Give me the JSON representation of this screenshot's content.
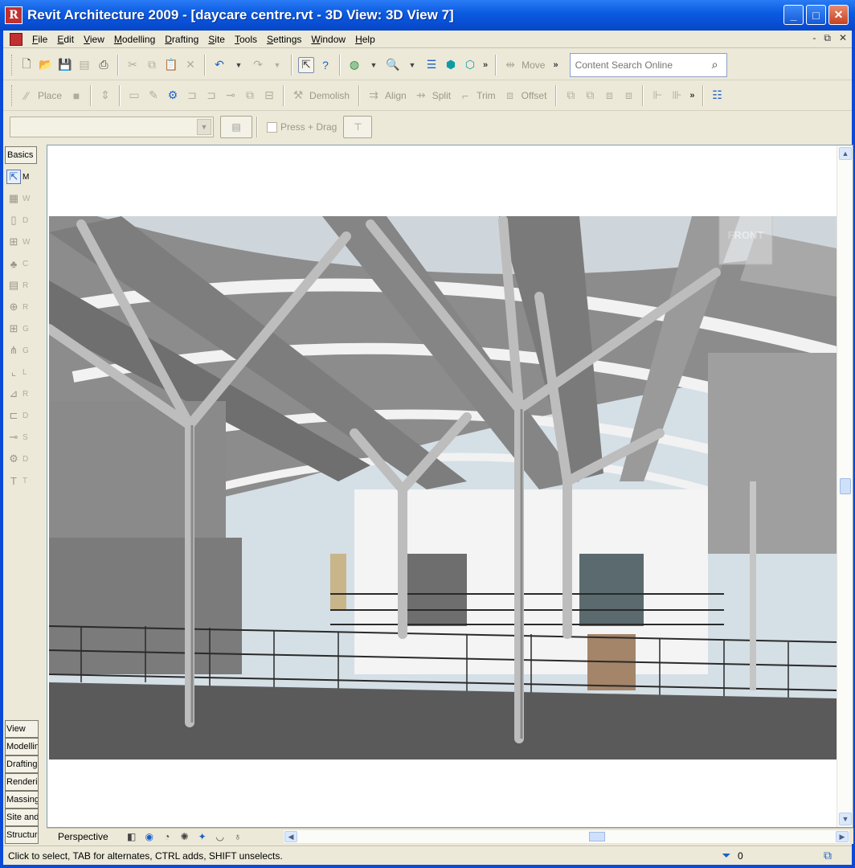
{
  "window": {
    "title": "Revit Architecture 2009 - [daycare centre.rvt - 3D View: 3D View 7]",
    "app_icon": "R",
    "minimize": "_",
    "maximize": "□",
    "close": "✕"
  },
  "menu": [
    {
      "label": "File",
      "key": "F",
      "rest": "ile"
    },
    {
      "label": "Edit",
      "key": "E",
      "rest": "dit"
    },
    {
      "label": "View",
      "key": "V",
      "rest": "iew"
    },
    {
      "label": "Modelling",
      "key": "M",
      "rest": "odelling"
    },
    {
      "label": "Drafting",
      "key": "D",
      "rest": "rafting"
    },
    {
      "label": "Site",
      "key": "S",
      "rest": "ite"
    },
    {
      "label": "Tools",
      "key": "T",
      "rest": "ools"
    },
    {
      "label": "Settings",
      "key": "S",
      "rest": "ettings"
    },
    {
      "label": "Window",
      "key": "W",
      "rest": "indow"
    },
    {
      "label": "Help",
      "key": "H",
      "rest": "elp"
    }
  ],
  "mdi_buttons": [
    "-",
    "⧉",
    "✕"
  ],
  "toolbar1": {
    "more": "»",
    "move_label": "Move",
    "search_placeholder": "Content Search Online"
  },
  "toolbar2": {
    "place_label": "Place",
    "demolish_label": "Demolish",
    "align_label": "Align",
    "split_label": "Split",
    "trim_label": "Trim",
    "offset_label": "Offset",
    "more": "»"
  },
  "toolbar3": {
    "press_drag_label": "Press + Drag"
  },
  "design_bar": {
    "tab": "Basics",
    "tools": [
      {
        "icon": "pointer-icon",
        "glyph": "⇱",
        "label": "M"
      },
      {
        "icon": "wall-icon",
        "glyph": "▦",
        "label": "W"
      },
      {
        "icon": "door-icon",
        "glyph": "▯",
        "label": "D"
      },
      {
        "icon": "window-icon",
        "glyph": "⊞",
        "label": "W"
      },
      {
        "icon": "component-icon",
        "glyph": "♣",
        "label": "C"
      },
      {
        "icon": "roof-icon",
        "glyph": "▤",
        "label": "R"
      },
      {
        "icon": "room-icon",
        "glyph": "⊕",
        "label": "R"
      },
      {
        "icon": "grid-icon",
        "glyph": "⊞",
        "label": "G"
      },
      {
        "icon": "column-icon",
        "glyph": "⋔",
        "label": "G"
      },
      {
        "icon": "level-icon",
        "glyph": "⌞",
        "label": "L"
      },
      {
        "icon": "floor-icon",
        "glyph": "⊿",
        "label": "R"
      },
      {
        "icon": "dimension-icon",
        "glyph": "⊏",
        "label": "D"
      },
      {
        "icon": "section-icon",
        "glyph": "⊸",
        "label": "S"
      },
      {
        "icon": "detail-icon",
        "glyph": "⚙",
        "label": "D"
      },
      {
        "icon": "text-icon",
        "glyph": "T",
        "label": "T"
      }
    ]
  },
  "browser_tabs": [
    "View",
    "Modelling",
    "Drafting",
    "Rendering",
    "Massing",
    "Site and",
    "Structure"
  ],
  "view_control": {
    "view_type": "Perspective"
  },
  "status": {
    "message": "Click to select, TAB for alternates, CTRL adds, SHIFT unselects.",
    "filter_count": "0"
  },
  "viewcube_label": "FRONT",
  "colors": {
    "title_blue": "#0a5ae0",
    "chrome": "#ece9d8",
    "floor": "#5a5a5a",
    "steel": "#9a9a9a"
  }
}
